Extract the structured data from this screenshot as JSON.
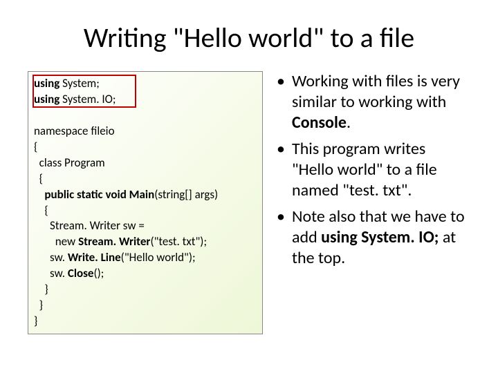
{
  "title": "Writing \"Hello world\" to a file",
  "code": {
    "l1a": "using",
    "l1b": " System;",
    "l2a": "using",
    "l2b": " System. IO;",
    "l4": "namespace fileio",
    "l5": "{",
    "l6": "  class Program",
    "l7": "  {",
    "l8a": "    public static void Main",
    "l8b": "(string[] args)",
    "l9": "    {",
    "l10": "      Stream. Writer sw =",
    "l11a": "        new ",
    "l11b": "Stream. Writer",
    "l11c": "(\"test. txt\");",
    "l12a": "      sw. ",
    "l12b": "Write. Line",
    "l12c": "(\"Hello world\");",
    "l13a": "      sw. ",
    "l13b": "Close",
    "l13c": "();",
    "l14": "    }",
    "l15": "  }",
    "l16": "}"
  },
  "bullets": {
    "b1_pre": "Working with files is very similar to working with ",
    "b1_bold": "Console",
    "b1_post": ".",
    "b2": "This program writes \"Hello world\" to a file named \"test. txt\".",
    "b3_pre": "Note also that we have to add ",
    "b3_bold": "using System. IO;",
    "b3_post": " at the top."
  }
}
